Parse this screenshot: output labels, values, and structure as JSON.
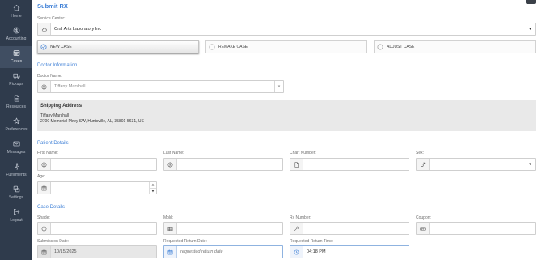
{
  "colors": {
    "accent": "#3d7fd6",
    "sidebar_bg": "#2f3b4c",
    "sidebar_active_bg": "#404e62",
    "sidebar_text": "#b9c0cb"
  },
  "sidebar": {
    "items": [
      {
        "label": "Home",
        "icon": "home-icon",
        "active": false
      },
      {
        "label": "Accounting",
        "icon": "dollar-circle-icon",
        "active": false
      },
      {
        "label": "Cases",
        "icon": "cases-icon",
        "active": true
      },
      {
        "label": "Pickups",
        "icon": "truck-icon",
        "active": false
      },
      {
        "label": "Resources",
        "icon": "document-icon",
        "active": false
      },
      {
        "label": "Preferences",
        "icon": "star-icon",
        "active": false
      },
      {
        "label": "Messages",
        "icon": "envelope-icon",
        "active": false
      },
      {
        "label": "Fulfillments",
        "icon": "fulfillment-icon",
        "active": false
      },
      {
        "label": "Settings",
        "icon": "settings-icon",
        "active": false
      },
      {
        "label": "Logout",
        "icon": "logout-icon",
        "active": false
      }
    ]
  },
  "app": {
    "title": "Submit RX"
  },
  "service_center": {
    "label": "Service Center:",
    "value": "Oral Arts Laboratory Inc",
    "icon": "cloud-icon"
  },
  "case_types": {
    "new": {
      "label": "NEW CASE",
      "selected": true
    },
    "remake": {
      "label": "REMAKE CASE",
      "selected": false
    },
    "adjust": {
      "label": "ADJUST CASE",
      "selected": false
    }
  },
  "doctor": {
    "section_title": "Doctor Information",
    "name_label": "Doctor Name:",
    "name_value": "Tiffany Marshall",
    "icon": "person-circle-icon"
  },
  "shipping": {
    "heading": "Shipping Address",
    "name": "Tiffany Marshall",
    "address": "2700 Memorial Pkwy SW, Huntsville, AL, 35801-5631, US"
  },
  "patient": {
    "section_title": "Patient Details",
    "first_name_label": "First Name:",
    "last_name_label": "Last Name:",
    "chart_number_label": "Chart Number:",
    "sex_label": "Sex:",
    "age_label": "Age:"
  },
  "case_details": {
    "section_title": "Case Details",
    "shade_label": "Shade:",
    "mold_label": "Mold:",
    "rx_number_label": "Rx Number:",
    "coupon_label": "Coupon:",
    "submission_date_label": "Submission Date:",
    "submission_date_value": "10/15/2025",
    "return_date_label": "Requested Return Date:",
    "return_date_placeholder": "requested return date",
    "return_time_label": "Requested Return Time:",
    "return_time_value": "04:18 PM"
  }
}
